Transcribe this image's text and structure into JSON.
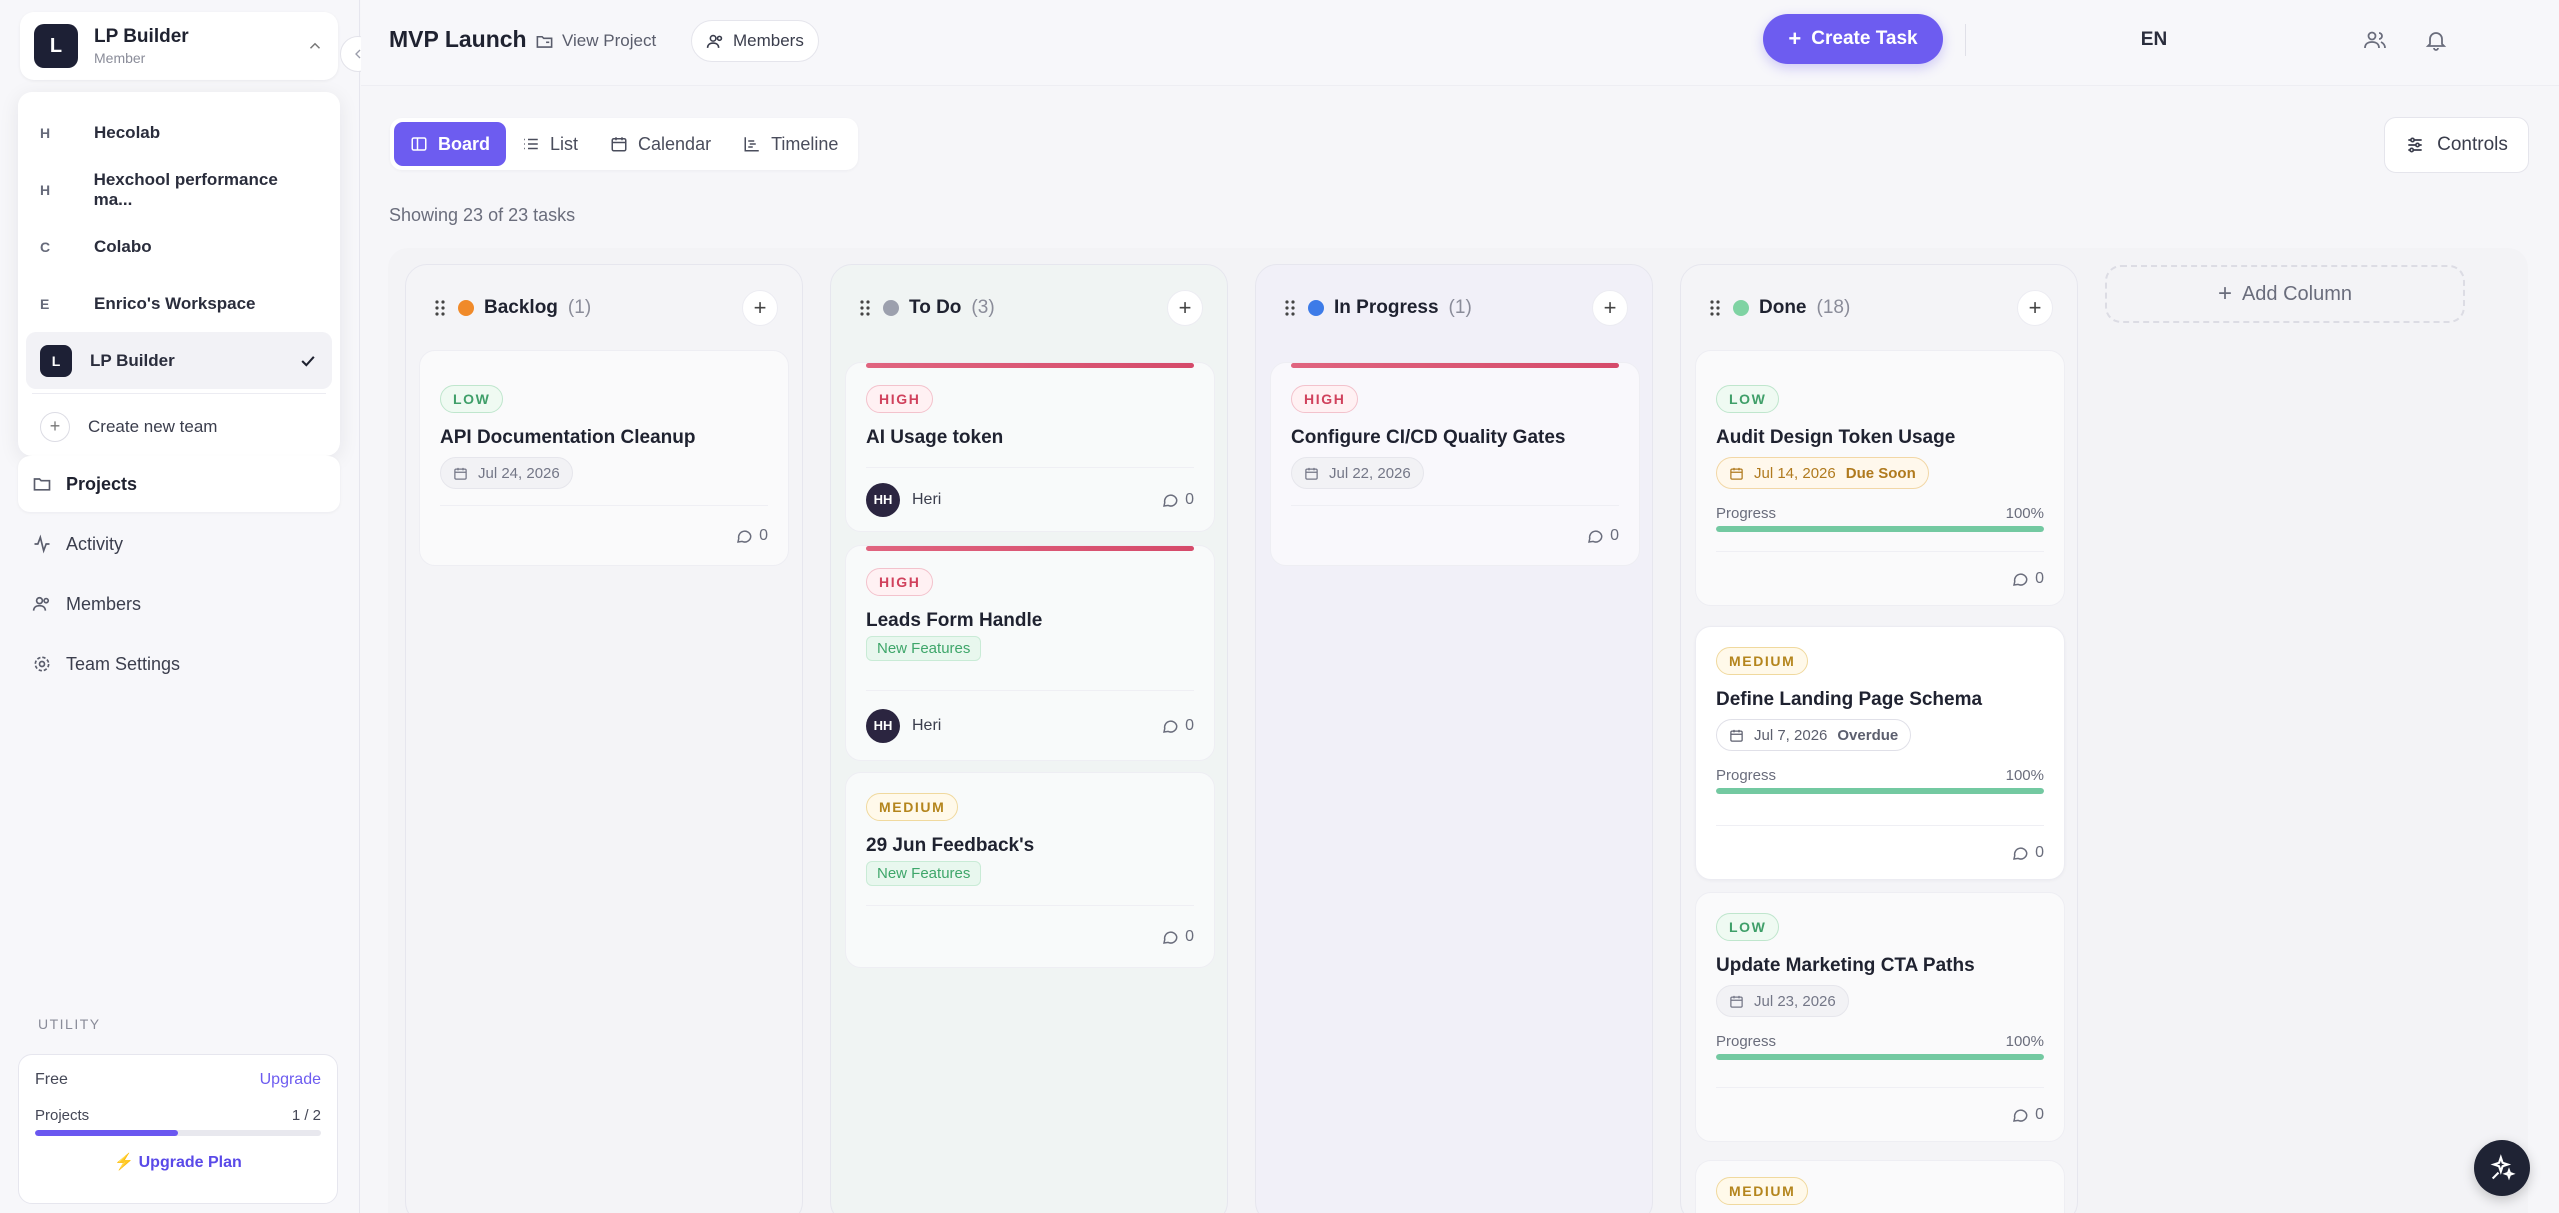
{
  "sidebar": {
    "team": {
      "initial": "L",
      "name": "LP Builder",
      "role": "Member"
    },
    "teams": [
      {
        "letter": "H",
        "name": "Hecolab"
      },
      {
        "letter": "H",
        "name": "Hexchool performance ma..."
      },
      {
        "letter": "C",
        "name": "Colabo"
      },
      {
        "letter": "E",
        "name": "Enrico's Workspace"
      },
      {
        "letter": "L",
        "name": "LP Builder"
      }
    ],
    "create_team": "Create new team",
    "nav": {
      "projects": "Projects",
      "activity": "Activity",
      "members": "Members",
      "settings": "Team Settings"
    },
    "utility_label": "UTILITY",
    "plan": {
      "name": "Free",
      "upgrade": "Upgrade",
      "projects_label": "Projects",
      "projects_count": "1 / 2",
      "projects_used": 1,
      "projects_max": 2,
      "upgrade_plan": "Upgrade Plan"
    }
  },
  "header": {
    "project_title": "MVP Launch",
    "view_project": "View Project",
    "members": "Members",
    "create_task": "Create Task",
    "lang": "EN"
  },
  "tabs": {
    "board": "Board",
    "list": "List",
    "calendar": "Calendar",
    "timeline": "Timeline"
  },
  "controls": "Controls",
  "showing": "Showing 23 of 23 tasks",
  "add_column": "Add Column",
  "columns": {
    "backlog": {
      "name": "Backlog",
      "count": "(1)",
      "color": "#f08a2a"
    },
    "todo": {
      "name": "To Do",
      "count": "(3)",
      "color": "#9ca0ad"
    },
    "inprogress": {
      "name": "In Progress",
      "count": "(1)",
      "color": "#3d7be8"
    },
    "done": {
      "name": "Done",
      "count": "(18)",
      "color": "#7fd3a3"
    }
  },
  "cards": {
    "b1": {
      "priority": "LOW",
      "title": "API Documentation Cleanup",
      "date": "Jul 24, 2026",
      "comments": "0"
    },
    "t1": {
      "priority": "HIGH",
      "title": "AI Usage token",
      "assignee_initials": "HH",
      "assignee": "Heri",
      "comments": "0"
    },
    "t2": {
      "priority": "HIGH",
      "title": "Leads Form Handle",
      "tag": "New Features",
      "assignee_initials": "HH",
      "assignee": "Heri",
      "comments": "0"
    },
    "t3": {
      "priority": "MEDIUM",
      "title": "29 Jun Feedback's",
      "tag": "New Features",
      "comments": "0"
    },
    "p1": {
      "priority": "HIGH",
      "title": "Configure CI/CD Quality Gates",
      "date": "Jul 22, 2026",
      "comments": "0"
    },
    "d1": {
      "priority": "LOW",
      "title": "Audit Design Token Usage",
      "date": "Jul 14, 2026",
      "date_status": "Due Soon",
      "progress_label": "Progress",
      "progress": "100%",
      "comments": "0"
    },
    "d2": {
      "priority": "MEDIUM",
      "title": "Define Landing Page Schema",
      "date": "Jul 7, 2026",
      "date_status": "Overdue",
      "progress_label": "Progress",
      "progress": "100%",
      "comments": "0"
    },
    "d3": {
      "priority": "LOW",
      "title": "Update Marketing CTA Paths",
      "date": "Jul 23, 2026",
      "progress_label": "Progress",
      "progress": "100%",
      "comments": "0"
    },
    "d4": {
      "priority": "MEDIUM"
    }
  }
}
